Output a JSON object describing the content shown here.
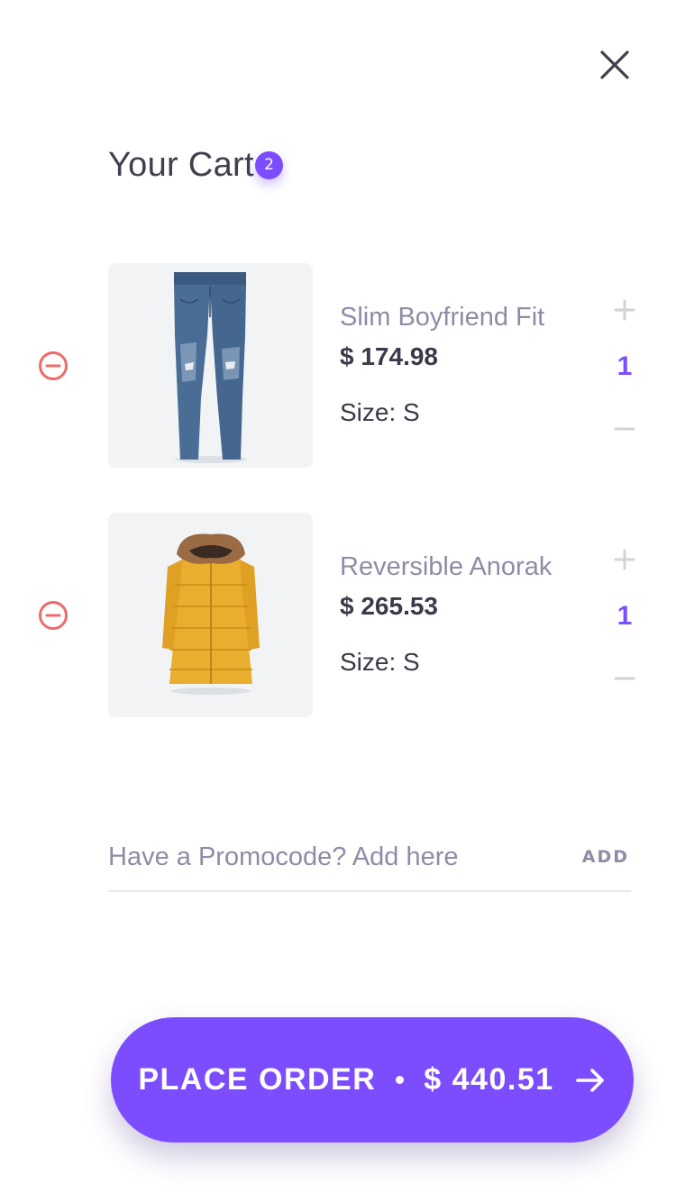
{
  "header": {
    "close_icon": "close-icon",
    "title": "Your Cart",
    "badge_count": "2"
  },
  "cart": {
    "items": [
      {
        "name": "Slim Boyfriend Fit",
        "price": "$ 174.98",
        "size": "Size: S",
        "quantity": "1",
        "image": "jeans-image"
      },
      {
        "name": "Reversible Anorak",
        "price": "$ 265.53",
        "size": "Size: S",
        "quantity": "1",
        "image": "anorak-image"
      }
    ]
  },
  "promo": {
    "placeholder": "Have a Promocode? Add here",
    "add_label": "ADD"
  },
  "footer": {
    "place_order_label": "PLACE ORDER",
    "total": "$ 440.51",
    "arrow_icon": "arrow-right-icon"
  },
  "colors": {
    "accent": "#7c4dff",
    "remove": "#f06a6a",
    "muted_text": "#8e8ca6",
    "dark_text": "#3a3a4a"
  }
}
